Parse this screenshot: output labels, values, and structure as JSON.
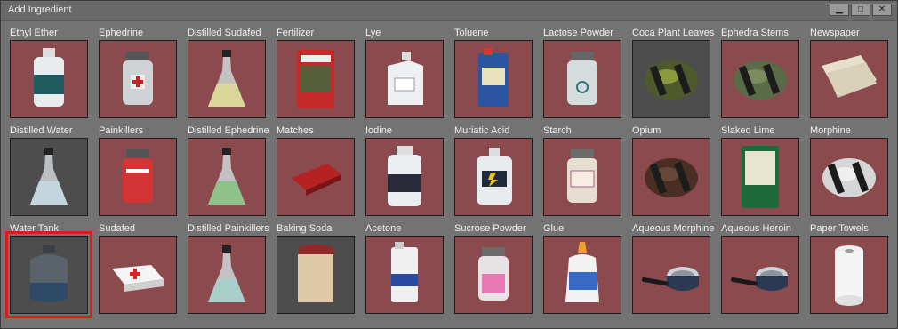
{
  "window": {
    "title": "Add Ingredient",
    "buttons": [
      {
        "name": "minimize",
        "glyph": "▁"
      },
      {
        "name": "maximize",
        "glyph": "□"
      },
      {
        "name": "close",
        "glyph": "✕"
      }
    ]
  },
  "ingredients": [
    {
      "label": "Ethyl Ether",
      "icon": "white-bottle-icon",
      "tile": "red"
    },
    {
      "label": "Ephedrine",
      "icon": "pill-jar-red-cross-icon",
      "tile": "red"
    },
    {
      "label": "Distilled Sudafed",
      "icon": "flask-yellow-icon",
      "tile": "red"
    },
    {
      "label": "Fertilizer",
      "icon": "fertilizer-bag-icon",
      "tile": "red"
    },
    {
      "label": "Lye",
      "icon": "lye-jug-icon",
      "tile": "red"
    },
    {
      "label": "Toluene",
      "icon": "toluene-can-icon",
      "tile": "red"
    },
    {
      "label": "Lactose Powder",
      "icon": "lactose-jar-icon",
      "tile": "red"
    },
    {
      "label": "Coca Plant Leaves",
      "icon": "leaf-bundle-icon",
      "tile": "dark"
    },
    {
      "label": "Ephedra Stems",
      "icon": "stem-bundle-icon",
      "tile": "red"
    },
    {
      "label": "Newspaper",
      "icon": "newspaper-icon",
      "tile": "red"
    },
    {
      "label": "Distilled Water",
      "icon": "flask-water-icon",
      "tile": "dark"
    },
    {
      "label": "Painkillers",
      "icon": "pill-jar-red-icon",
      "tile": "red"
    },
    {
      "label": "Distilled Ephedrine",
      "icon": "flask-green-icon",
      "tile": "red"
    },
    {
      "label": "Matches",
      "icon": "matchbox-icon",
      "tile": "red"
    },
    {
      "label": "Iodine",
      "icon": "iodine-bottle-icon",
      "tile": "red"
    },
    {
      "label": "Muriatic Acid",
      "icon": "acid-jug-icon",
      "tile": "red"
    },
    {
      "label": "Starch",
      "icon": "starch-jar-icon",
      "tile": "red"
    },
    {
      "label": "Opium",
      "icon": "opium-bundle-icon",
      "tile": "red"
    },
    {
      "label": "Slaked Lime",
      "icon": "lime-bag-icon",
      "tile": "red"
    },
    {
      "label": "Morphine",
      "icon": "morphine-bundle-icon",
      "tile": "red"
    },
    {
      "label": "Water Tank",
      "icon": "water-tank-icon",
      "tile": "dark",
      "selected": true
    },
    {
      "label": "Sudafed",
      "icon": "sudafed-box-icon",
      "tile": "red"
    },
    {
      "label": "Distilled Painkillers",
      "icon": "flask-teal-icon",
      "tile": "red"
    },
    {
      "label": "Baking Soda",
      "icon": "baking-soda-can-icon",
      "tile": "dark"
    },
    {
      "label": "Acetone",
      "icon": "acetone-can-icon",
      "tile": "red"
    },
    {
      "label": "Sucrose Powder",
      "icon": "sucrose-jar-icon",
      "tile": "red"
    },
    {
      "label": "Glue",
      "icon": "glue-bottle-icon",
      "tile": "red"
    },
    {
      "label": "Aqueous Morphine",
      "icon": "saucepan-icon",
      "tile": "red"
    },
    {
      "label": "Aqueous Heroin",
      "icon": "saucepan-icon",
      "tile": "red"
    },
    {
      "label": "Paper Towels",
      "icon": "paper-towel-roll-icon",
      "tile": "red"
    }
  ],
  "tile_text": {
    "Fertilizer": [
      "BERGON",
      "WASTE",
      "FERTILIZER"
    ],
    "Lye": [
      "LYE"
    ],
    "Matches": [
      "MATCHES"
    ],
    "Slaked Lime": [
      "BERGON",
      "SLAKED",
      "LIME"
    ],
    "Baking Soda": [
      "PH",
      "BAKING",
      "SODA"
    ],
    "Glue": [
      "GLUE"
    ],
    "Acetone": [
      "ACETONE"
    ],
    "Starch": [
      "TAPIOCA",
      "STARCH"
    ],
    "Lactose Powder": [
      "LACTOSE",
      "POWDER"
    ]
  },
  "colors": {
    "tile_red": "#8b4a4e",
    "tile_dark": "#4d4d4d",
    "selection": "#e01a1a"
  }
}
